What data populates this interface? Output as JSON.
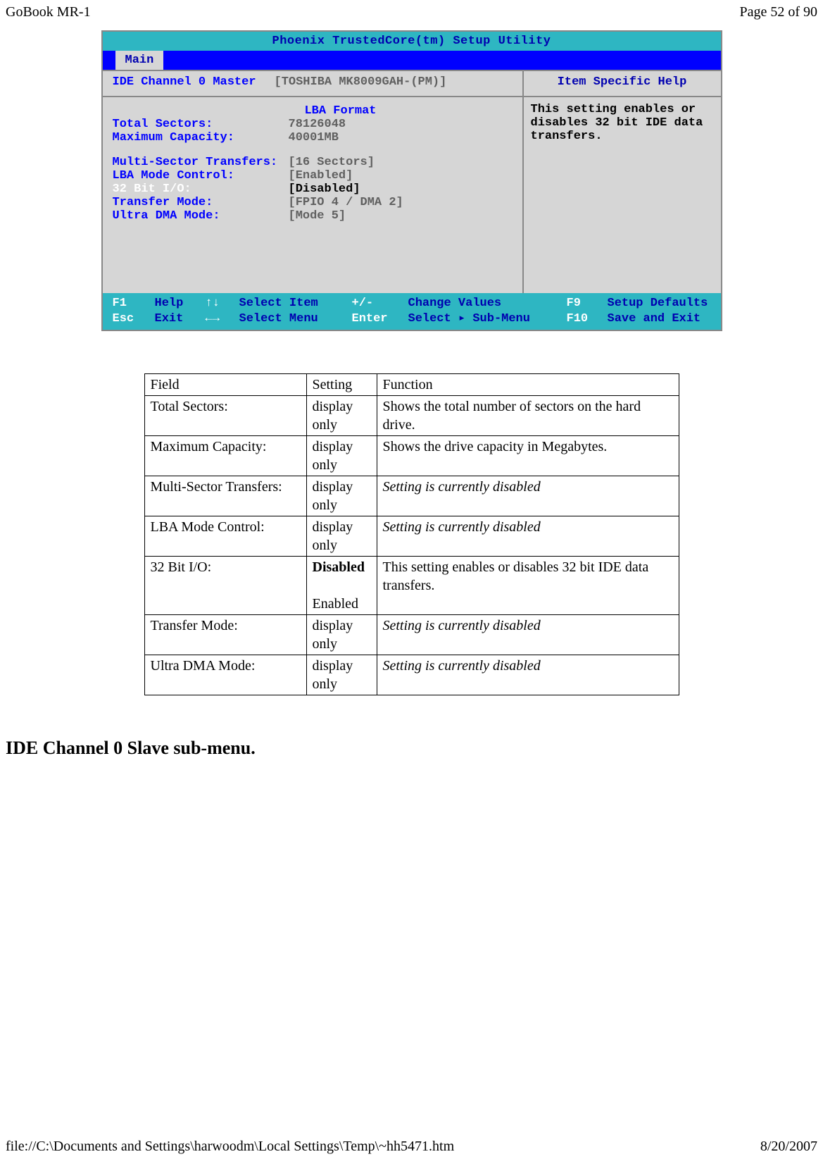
{
  "header": {
    "left": "GoBook MR-1",
    "right": "Page 52 of 90"
  },
  "bios": {
    "title": "Phoenix TrustedCore(tm) Setup Utility",
    "menu_tab": "Main",
    "top_label": "IDE Channel 0 Master",
    "top_value": "[TOSHIBA MK8009GAH-(PM)]",
    "help_head": "Item Specific Help",
    "lba_header": "LBA Format",
    "fields": {
      "total_sectors": {
        "k": "Total Sectors:",
        "v": "78126048"
      },
      "max_capacity": {
        "k": "Maximum Capacity:",
        "v": "40001MB"
      },
      "multi_sector": {
        "k": "Multi-Sector Transfers:",
        "v": "[16 Sectors]"
      },
      "lba_mode": {
        "k": "LBA Mode Control:",
        "v": "[Enabled]"
      },
      "bit32": {
        "k": "32 Bit I/O:",
        "v": "[Disabled]"
      },
      "transfer": {
        "k": "Transfer Mode:",
        "v": "[FPIO 4 / DMA 2]"
      },
      "ultra_dma": {
        "k": "Ultra DMA Mode:",
        "v": "[Mode 5]"
      }
    },
    "help_body": "This setting enables or disables 32 bit IDE data transfers.",
    "footer": {
      "r1": {
        "k1": "F1",
        "t1": "Help",
        "k2": "↑↓",
        "t2": "Select Item",
        "k3": "+/-",
        "t3": "Change Values",
        "k4": "F9",
        "t4": "Setup Defaults"
      },
      "r2": {
        "k1": "Esc",
        "t1": "Exit",
        "k2": "←→",
        "t2": "Select Menu",
        "k3": "Enter",
        "t3": "Select ▸ Sub-Menu",
        "k4": "F10",
        "t4": "Save and Exit"
      }
    }
  },
  "table": {
    "head": {
      "c1": "Field",
      "c2": "Setting",
      "c3": "Function"
    },
    "rows": [
      {
        "c1": "Total Sectors:",
        "c2": "display only",
        "c3": "Shows the total number of sectors on the hard drive."
      },
      {
        "c1": "Maximum Capacity:",
        "c2": "display only",
        "c3": "Shows the drive capacity in Megabytes."
      },
      {
        "c1": "Multi-Sector Transfers:",
        "c2": "display only",
        "c3_em": "Setting is currently disabled"
      },
      {
        "c1": "LBA Mode Control:",
        "c2": "display only",
        "c3_em": "Setting is currently disabled"
      },
      {
        "c1": "32 Bit I/O:",
        "c2_b": "Disabled",
        "c2_2": "Enabled",
        "c3": "This setting enables or disables 32 bit IDE data transfers."
      },
      {
        "c1": "Transfer Mode:",
        "c2": "display only",
        "c3_em": "Setting is currently disabled"
      },
      {
        "c1": "Ultra DMA Mode:",
        "c2": "display only",
        "c3_em": "Setting is currently disabled"
      }
    ]
  },
  "section_heading": "IDE Channel 0 Slave sub-menu.",
  "footer_bar": {
    "left": "file://C:\\Documents and Settings\\harwoodm\\Local Settings\\Temp\\~hh5471.htm",
    "right": "8/20/2007"
  }
}
